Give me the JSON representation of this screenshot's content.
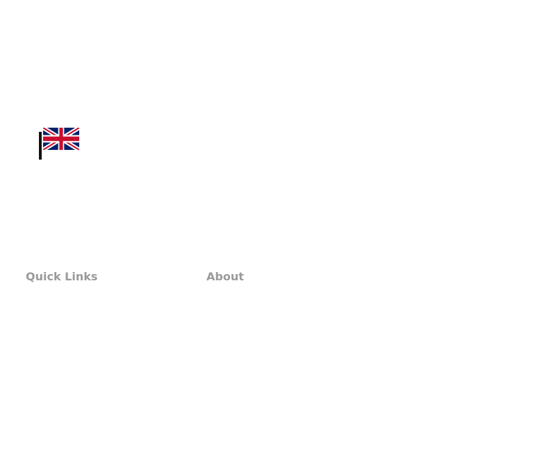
{
  "language_selector": {
    "flag_icon": "uk-flag-icon"
  },
  "footer": {
    "quick_links_heading": "Quick Links",
    "about_heading": "About"
  },
  "colors": {
    "heading_text": "#9a9a9a",
    "flag_blue": "#012169",
    "flag_red": "#C8102E",
    "flag_white": "#FFFFFF",
    "pole": "#111111"
  }
}
